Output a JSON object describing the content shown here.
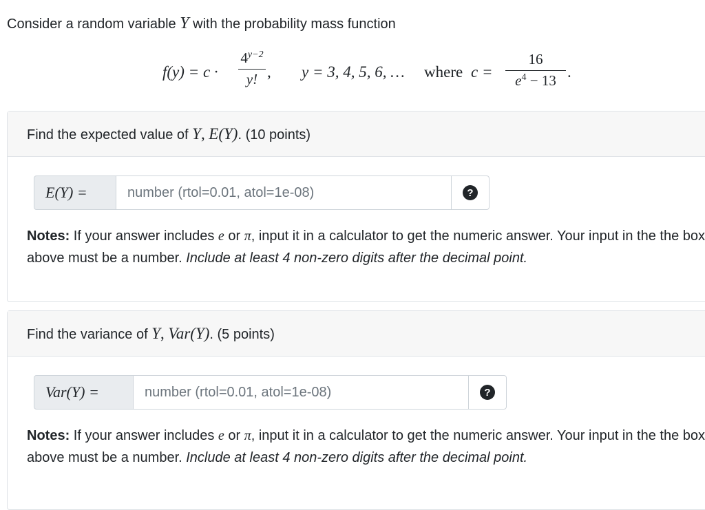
{
  "intro": {
    "prefix": "Consider a random variable",
    "var": "Y",
    "suffix": "with the probability mass function"
  },
  "formula": {
    "lhs": "f(y) = c ·",
    "num_base": "4",
    "num_exp": "y−2",
    "den": "y!",
    "comma": ",",
    "support": "y = 3, 4, 5, 6, … ",
    "where": "where",
    "c_eq": "c =",
    "c_num": "16",
    "c_den_base": "e",
    "c_den_exp": "4",
    "c_den_rest": " − 13",
    "period": "."
  },
  "q1": {
    "prefix": "Find the expected value of",
    "var": "Y",
    "sep": ",",
    "expr": "E(Y)",
    "suffix": ". (10 points)",
    "label": "E(Y) =",
    "placeholder": "number (rtol=0.01, atol=1e-08)",
    "help": "?",
    "notes_bold": "Notes:",
    "notes_text1": " If your answer includes ",
    "notes_e": "e",
    "notes_or": " or ",
    "notes_pi": "π",
    "notes_text2": ", input it in a calculator to get the numeric answer. Your input in the the box above must be a number. ",
    "notes_italic": "Include at least 4 non-zero digits after the decimal point."
  },
  "q2": {
    "prefix": "Find the variance of",
    "var": "Y",
    "sep": ",",
    "expr": "Var(Y)",
    "suffix": ". (5 points)",
    "label": "Var(Y) =",
    "placeholder": "number (rtol=0.01, atol=1e-08)",
    "help": "?",
    "notes_bold": "Notes:",
    "notes_text1": " If your answer includes ",
    "notes_e": "e",
    "notes_or": " or ",
    "notes_pi": "π",
    "notes_text2": ", input it in a calculator to get the numeric answer. Your input in the the box above must be a number. ",
    "notes_italic": "Include at least 4 non-zero digits after the decimal point."
  }
}
